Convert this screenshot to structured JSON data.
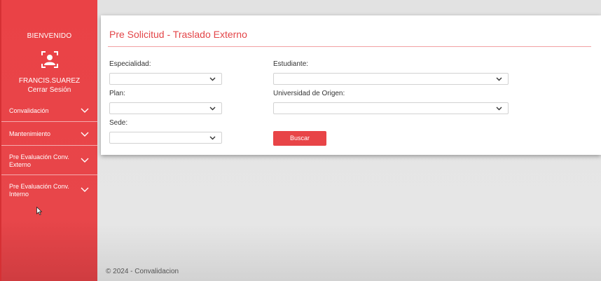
{
  "sidebar": {
    "welcome": "BIENVENIDO",
    "user_icon": "user-badge-icon",
    "username": "FRANCIS.SUAREZ",
    "logout": "Cerrar Sesión",
    "menu": [
      {
        "label": "Convalidación",
        "icon": "chevron-down-icon"
      },
      {
        "label": "Mantenimiento",
        "icon": "chevron-down-icon"
      },
      {
        "label": "Pre Evaluación Conv. Externo",
        "icon": "chevron-down-icon"
      },
      {
        "label": "Pre Evaluación Conv. Interno",
        "icon": "chevron-down-icon"
      }
    ]
  },
  "form": {
    "title": "Pre Solicitud - Traslado Externo",
    "fields": {
      "especialidad": {
        "label": "Especialidad:",
        "value": ""
      },
      "plan": {
        "label": "Plan:",
        "value": ""
      },
      "sede": {
        "label": "Sede:",
        "value": ""
      },
      "estudiante": {
        "label": "Estudiante:",
        "value": ""
      },
      "universidad": {
        "label": "Universidad de Origen:",
        "value": ""
      }
    },
    "search_button": "Buscar"
  },
  "footer": {
    "text": "© 2024 - Convalidacion"
  },
  "colors": {
    "brand": "#e84447",
    "sidebar": "#ea4246",
    "title": "#e34548"
  }
}
